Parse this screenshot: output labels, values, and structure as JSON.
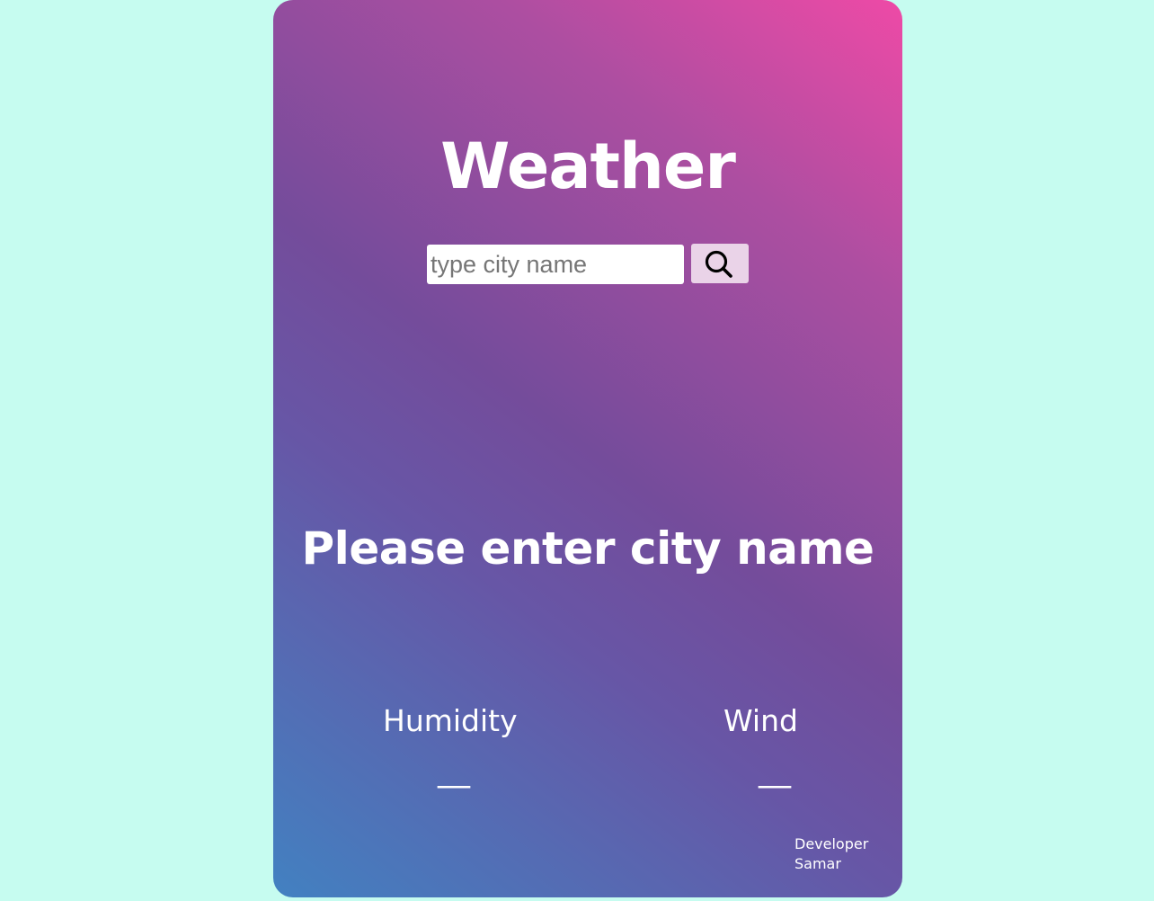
{
  "app": {
    "title": "Weather"
  },
  "search": {
    "placeholder": "type city name",
    "value": "",
    "button_icon": "search-icon"
  },
  "main": {
    "message": "Please enter city name"
  },
  "stats": {
    "humidity": {
      "label": "Humidity",
      "value": "__"
    },
    "wind": {
      "label": "Wind",
      "value": "__"
    }
  },
  "footer": {
    "line1": "Developer",
    "line2": "Samar"
  },
  "colors": {
    "page_background": "#c6fcf0",
    "gradient_start": "#4281c1",
    "gradient_mid": "#744c9b",
    "gradient_end": "#ee4aa6",
    "search_button_bg": "#ead3e8",
    "text": "#ffffff"
  }
}
